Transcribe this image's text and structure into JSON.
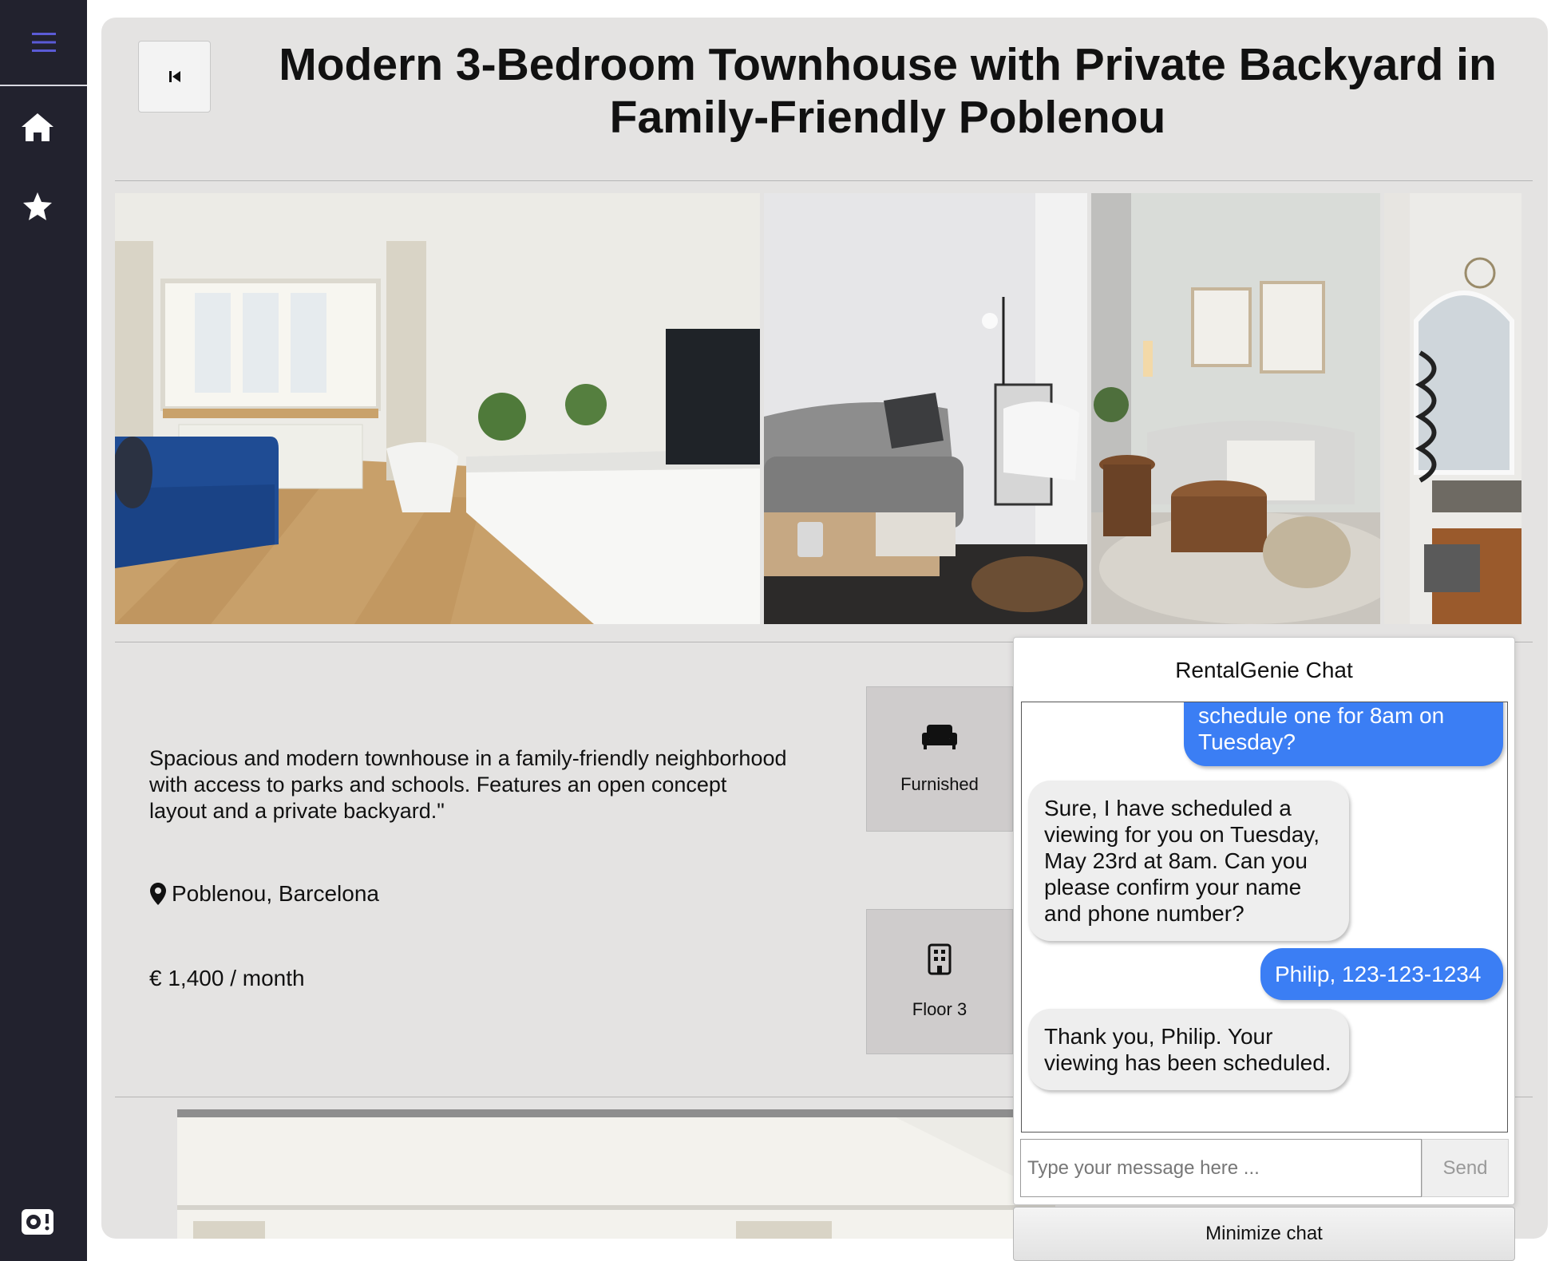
{
  "sidebar": {
    "menu_icon": "hamburger-icon",
    "items": [
      {
        "icon": "home-icon",
        "label": "Home"
      },
      {
        "icon": "star-icon",
        "label": "Favorites"
      }
    ],
    "bottom_icon": "speaker-icon"
  },
  "listing": {
    "title": "Modern 3-Bedroom Townhouse with Private Backyard in Family-Friendly Poblenou",
    "description": "Spacious and modern townhouse in a family-friendly neighborhood with access to parks and schools. Features an open concept layout and a private backyard.\"",
    "location": "Poblenou, Barcelona",
    "price": "€ 1,400 / month",
    "features": [
      {
        "icon": "sofa-icon",
        "label": "Furnished"
      },
      {
        "icon": "building-icon",
        "label": "Floor 3"
      }
    ]
  },
  "chat": {
    "title": "RentalGenie Chat",
    "messages": [
      {
        "from": "user",
        "text": "schedule one for 8am on Tuesday?"
      },
      {
        "from": "bot",
        "text": "Sure, I have scheduled a viewing for you on Tuesday, May 23rd at 8am. Can you please confirm your name and phone number?"
      },
      {
        "from": "user",
        "text": "Philip, 123-123-1234"
      },
      {
        "from": "bot",
        "text": "Thank you, Philip. Your viewing has been scheduled."
      }
    ],
    "input_placeholder": "Type your message here ...",
    "input_value": "",
    "send_label": "Send",
    "minimize_label": "Minimize chat"
  },
  "colors": {
    "sidebar": "#22222e",
    "accent": "#5b5bd6",
    "user_bubble": "#3b7ef4",
    "bot_bubble": "#eeeeee",
    "panel": "#e4e3e2"
  }
}
